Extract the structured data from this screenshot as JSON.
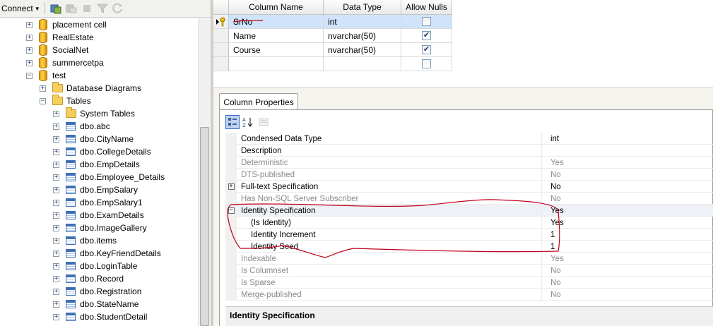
{
  "toolbar": {
    "connect_label": "Connect",
    "icons": [
      "connect-caret-icon",
      "register-server-icon",
      "disconnect-icon",
      "stop-icon",
      "filter-icon",
      "refresh-icon"
    ]
  },
  "tree": {
    "databases": [
      {
        "label": "placement cell",
        "expanded": false
      },
      {
        "label": "RealEstate",
        "expanded": false
      },
      {
        "label": "SocialNet",
        "expanded": false
      },
      {
        "label": "summercetpa",
        "expanded": false
      },
      {
        "label": "test",
        "expanded": true
      }
    ],
    "test_children": {
      "database_diagrams": "Database Diagrams",
      "tables": "Tables",
      "system_tables": "System Tables",
      "table_items": [
        "dbo.abc",
        "dbo.CityName",
        "dbo.CollegeDetails",
        "dbo.EmpDetails",
        "dbo.Employee_Details",
        "dbo.EmpSalary",
        "dbo.EmpSalary1",
        "dbo.ExamDetails",
        "dbo.ImageGallery",
        "dbo.items",
        "dbo.KeyFriendDetails",
        "dbo.LoginTable",
        "dbo.Record",
        "dbo.Registration",
        "dbo.StateName",
        "dbo.StudentDetail"
      ]
    }
  },
  "designer": {
    "headers": {
      "column_name": "Column Name",
      "data_type": "Data Type",
      "allow_nulls": "Allow Nulls"
    },
    "rows": [
      {
        "name": "SrNo",
        "type": "int",
        "allow_nulls": false,
        "primary_key": true
      },
      {
        "name": "Name",
        "type": "nvarchar(50)",
        "allow_nulls": true,
        "primary_key": false
      },
      {
        "name": "Course",
        "type": "nvarchar(50)",
        "allow_nulls": true,
        "primary_key": false
      },
      {
        "name": "",
        "type": "",
        "allow_nulls": false,
        "primary_key": false
      }
    ]
  },
  "column_properties": {
    "tab_label": "Column Properties",
    "rows": [
      {
        "name": "Condensed Data Type",
        "value": "int",
        "readonly": false,
        "expander": "",
        "indent": false
      },
      {
        "name": "Description",
        "value": "",
        "readonly": false,
        "expander": "",
        "indent": false
      },
      {
        "name": "Deterministic",
        "value": "Yes",
        "readonly": true,
        "expander": "",
        "indent": false
      },
      {
        "name": "DTS-published",
        "value": "No",
        "readonly": true,
        "expander": "",
        "indent": false
      },
      {
        "name": "Full-text Specification",
        "value": "No",
        "readonly": false,
        "expander": "+",
        "indent": false
      },
      {
        "name": "Has Non-SQL Server Subscriber",
        "value": "No",
        "readonly": true,
        "expander": "",
        "indent": false
      },
      {
        "name": "Identity Specification",
        "value": "Yes",
        "readonly": false,
        "expander": "−",
        "indent": false
      },
      {
        "name": "(Is Identity)",
        "value": "Yes",
        "readonly": false,
        "expander": "",
        "indent": true
      },
      {
        "name": "Identity Increment",
        "value": "1",
        "readonly": false,
        "expander": "",
        "indent": true
      },
      {
        "name": "Identity Seed",
        "value": "1",
        "readonly": false,
        "expander": "",
        "indent": true
      },
      {
        "name": "Indexable",
        "value": "Yes",
        "readonly": true,
        "expander": "",
        "indent": false
      },
      {
        "name": "Is Columnset",
        "value": "No",
        "readonly": true,
        "expander": "",
        "indent": false
      },
      {
        "name": "Is Sparse",
        "value": "No",
        "readonly": true,
        "expander": "",
        "indent": false
      },
      {
        "name": "Merge-published",
        "value": "No",
        "readonly": true,
        "expander": "",
        "indent": false
      }
    ],
    "description_title": "Identity Specification"
  },
  "colors": {
    "annotation": "#c0001a",
    "selection": "#cfe4fa",
    "panel_bg": "#f5f4ef"
  }
}
